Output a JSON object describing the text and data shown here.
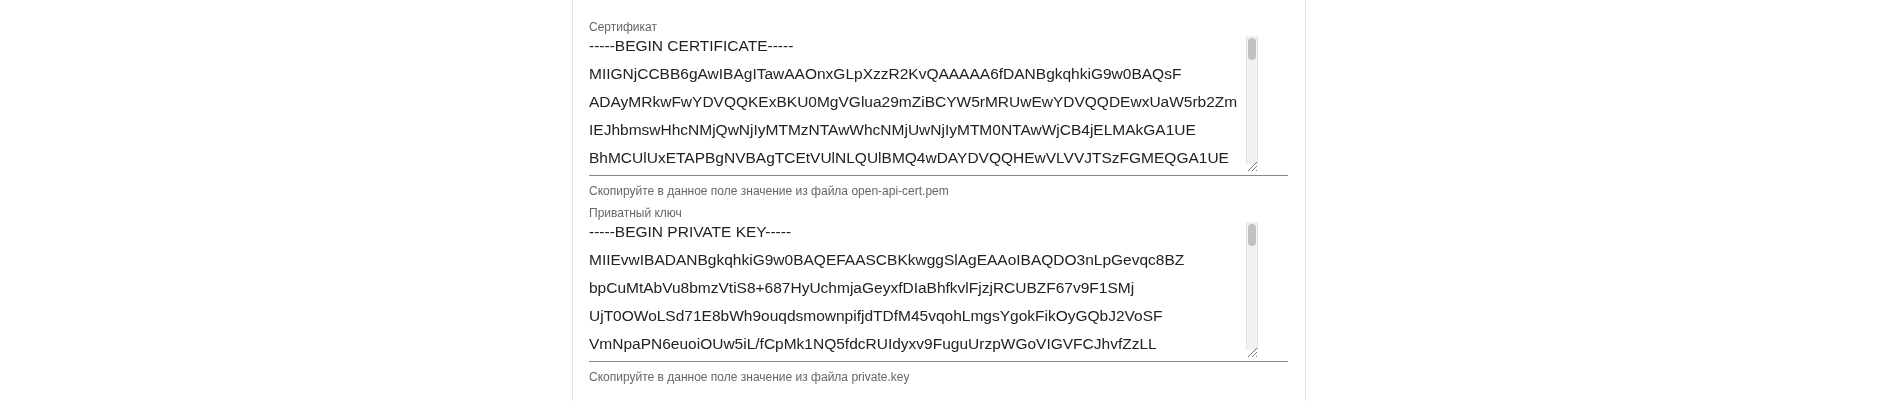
{
  "fields": [
    {
      "label": "Сертификат",
      "lines": [
        "-----BEGIN CERTIFICATE-----",
        "MIIGNjCCBB6gAwIBAgITawAAOnxGLpXzzR2KvQAAAAA6fDANBgkqhkiG9w0BAQsF",
        "ADAyMRkwFwYDVQQKExBKU0MgVGlua29mZiBCYW5rMRUwEwYDVQQDEwxUaW5rb2Zm",
        "IEJhbmswHhcNMjQwNjIyMTMzNTAwWhcNMjUwNjIyMTM0NTAwWjCB4jELMAkGA1UE",
        "BhMCUlUxETAPBgNVBAgTCEtVUlNLQUlBMQ4wDAYDVQQHEwVLVVJTSzFGMEQGA1UE"
      ],
      "helper": "Скопируйте в данное поле значение из файла open-api-cert.pem"
    },
    {
      "label": "Приватный ключ",
      "lines": [
        "-----BEGIN PRIVATE KEY-----",
        "MIIEvwIBADANBgkqhkiG9w0BAQEFAASCBKkwggSlAgEAAoIBAQDO3nLpGevqc8BZ",
        "bpCuMtAbVu8bmzVtiS8+687HyUchmjaGeyxfDIaBhfkvlFjzjRCUBZF67v9F1SMj",
        "UjT0OWoLSd71E8bWh9ouqdsmownpifjdTDfM45vqohLmgsYgokFikOyGQbJ2VoSF",
        "VmNpaPN6euoiOUw5iL/fCpMk1NQ5fdcRUIdyxv9FuguUrzpWGoVIGVFCJhvfZzLL"
      ],
      "helper": "Скопируйте в данное поле значение из файла private.key"
    }
  ]
}
